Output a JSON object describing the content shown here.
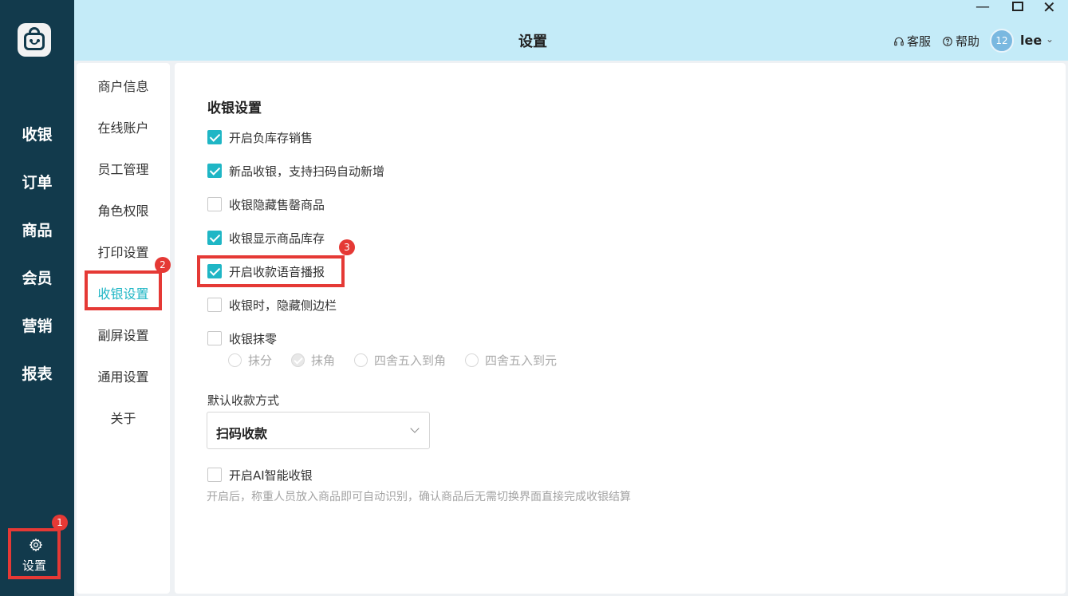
{
  "nav": {
    "items": [
      "收银",
      "订单",
      "商品",
      "会员",
      "营销",
      "报表"
    ],
    "settings_label": "设置",
    "settings_badge": "1"
  },
  "header": {
    "title": "设置",
    "service_label": "客服",
    "help_label": "帮助",
    "avatar_text": "12",
    "username": "lee"
  },
  "submenu": {
    "items": [
      "商户信息",
      "在线账户",
      "员工管理",
      "角色权限",
      "打印设置",
      "收银设置",
      "副屏设置",
      "通用设置",
      "关于"
    ],
    "active": "收银设置",
    "badge": "2"
  },
  "content": {
    "section_title": "收银设置",
    "options": [
      {
        "label": "开启负库存销售",
        "checked": true
      },
      {
        "label": "新品收银，支持扫码自动新增",
        "checked": true
      },
      {
        "label": "收银隐藏售罄商品",
        "checked": false
      },
      {
        "label": "收银显示商品库存",
        "checked": true
      },
      {
        "label": "开启收款语音播报",
        "checked": true
      },
      {
        "label": "收银时，隐藏侧边栏",
        "checked": false
      },
      {
        "label": "收银抹零",
        "checked": false
      }
    ],
    "highlight_badge": "3",
    "rounding_options": [
      {
        "label": "抹分",
        "selected": false
      },
      {
        "label": "抹角",
        "selected": true
      },
      {
        "label": "四舍五入到角",
        "selected": false
      },
      {
        "label": "四舍五入到元",
        "selected": false
      }
    ],
    "payment_label": "默认收款方式",
    "payment_value": "扫码收款",
    "ai_option": {
      "label": "开启AI智能收银",
      "checked": false
    },
    "ai_hint": "开启后，称重人员放入商品即可自动识别，确认商品后无需切换界面直接完成收银结算"
  }
}
